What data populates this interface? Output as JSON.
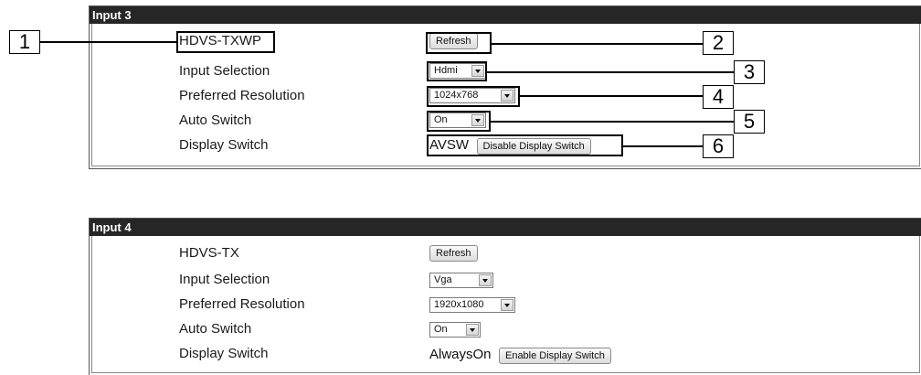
{
  "panels": [
    {
      "title": "Input 3",
      "device": "HDVS-TXWP",
      "refresh_label": "Refresh",
      "input_selection_label": "Input Selection",
      "input_selection_value": "Hdmi",
      "preferred_resolution_label": "Preferred Resolution",
      "preferred_resolution_value": "1024x768",
      "auto_switch_label": "Auto Switch",
      "auto_switch_value": "On",
      "display_switch_label": "Display Switch",
      "display_switch_status": "AVSW",
      "display_switch_button": "Disable Display Switch"
    },
    {
      "title": "Input 4",
      "device": "HDVS-TX",
      "refresh_label": "Refresh",
      "input_selection_label": "Input Selection",
      "input_selection_value": "Vga",
      "preferred_resolution_label": "Preferred Resolution",
      "preferred_resolution_value": "1920x1080",
      "auto_switch_label": "Auto Switch",
      "auto_switch_value": "On",
      "display_switch_label": "Display Switch",
      "display_switch_status": "AlwaysOn",
      "display_switch_button": "Enable Display Switch"
    }
  ],
  "callouts": [
    "1",
    "2",
    "3",
    "4",
    "5",
    "6"
  ]
}
